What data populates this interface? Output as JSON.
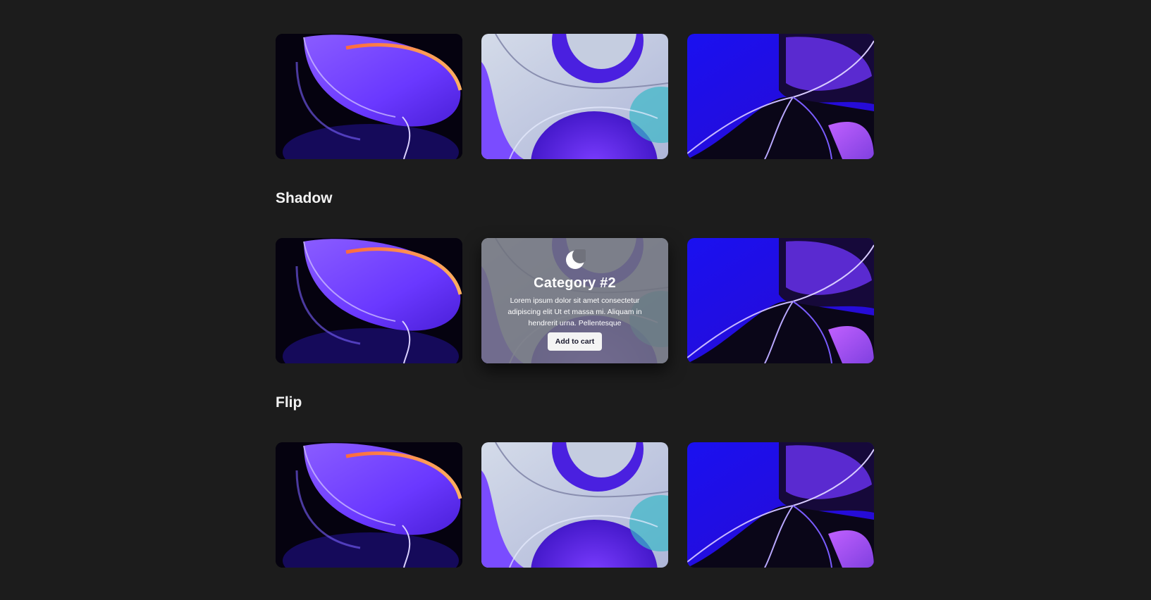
{
  "colors": {
    "background": "#1c1c1c",
    "card_overlay": "#70727c",
    "button_bg": "#f4f4f4",
    "button_text": "#1a1a2e",
    "violet": "#6a38ff",
    "blue": "#1a10f0",
    "pale_lilac": "#c5cde0"
  },
  "sections": [
    {
      "title": "",
      "cards": [
        {
          "image": "violet-disc-abstract"
        },
        {
          "image": "lilac-glass-abstract"
        },
        {
          "image": "blue-glass-abstract"
        }
      ]
    },
    {
      "title": "Shadow",
      "cards": [
        {
          "image": "violet-disc-abstract"
        },
        {
          "image": "lilac-glass-abstract"
        },
        {
          "image": "blue-glass-abstract"
        }
      ]
    },
    {
      "title": "Flip",
      "cards": [
        {
          "image": "violet-disc-abstract"
        },
        {
          "image": "lilac-glass-abstract"
        },
        {
          "image": "blue-glass-abstract"
        }
      ]
    }
  ],
  "hover_card": {
    "icon": "moon-icon",
    "title": "Category #2",
    "description": "Lorem ipsum dolor sit amet consectetur adipiscing elit Ut et massa mi. Aliquam in hendrerit urna. Pellentesque",
    "button_label": "Add to cart"
  }
}
